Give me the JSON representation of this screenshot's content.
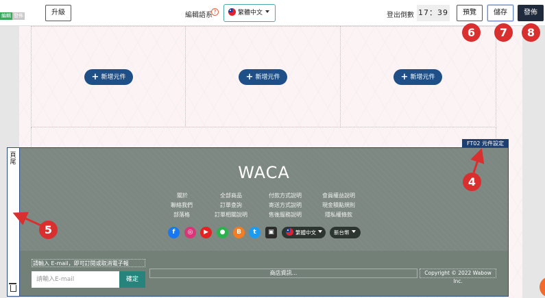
{
  "toolbar": {
    "tag_edit": "編輯",
    "tag_publish": "發佈",
    "upgrade_label": "升級",
    "language_label": "編輯語系",
    "help_icon": "question-circle-icon",
    "language_value": "繁體中文",
    "logout_label": "登出倒數",
    "timer": "17：39",
    "preview_label": "預覽",
    "save_label": "儲存",
    "publish_label": "發佈"
  },
  "canvas": {
    "add_element_label": "新增元件",
    "footer_tag": "FT02 元件設定"
  },
  "side_panel": {
    "label": "頁尾"
  },
  "footer": {
    "brand": "WACA",
    "links": [
      [
        "關於",
        "全部商品",
        "付款方式說明",
        "會員權益說明"
      ],
      [
        "聯絡我們",
        "訂單查詢",
        "寄送方式說明",
        "現金積點規則"
      ],
      [
        "部落格",
        "訂單相關說明",
        "售後服務說明",
        "隱私權條款"
      ]
    ],
    "social_icons": [
      "facebook-icon",
      "instagram-icon",
      "youtube-icon",
      "line-icon",
      "blogger-icon",
      "twitter-icon",
      "shop-icon"
    ],
    "language_pill": "繁體中文",
    "currency_pill": "新台幣",
    "newsletter_label": "請輸入 E-mail，即可訂閱或取消電子報",
    "email_placeholder": "請輸入E-mail",
    "confirm_label": "確定",
    "store_info": "商店資訊...",
    "copyright": "Copyright © 2022 Wabow Inc."
  },
  "annotations": {
    "markers": [
      "6",
      "7",
      "8",
      "4",
      "5"
    ],
    "color": "#d92f2f"
  },
  "colors": {
    "primary_button": "#1e4f86",
    "publish_button": "#1f2a3c",
    "footer_bg": "#7d8882",
    "confirm_button": "#27847d"
  }
}
